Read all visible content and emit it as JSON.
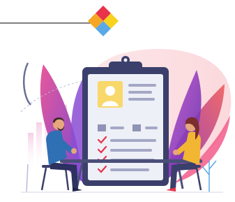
{
  "illustration": {
    "subject": "recruitment-interview",
    "colors": {
      "accent_red": "#e8334a",
      "accent_orange": "#f5a623",
      "accent_yellow": "#f8d21c",
      "accent_blue": "#5aa9e6",
      "clipboard_frame": "#3b3f6b",
      "paper": "#eef0f7",
      "check": "#e8334a",
      "leaf_purple": "#7b4bd1",
      "leaf_pink": "#e8579b",
      "man_shirt": "#2f6fb3",
      "woman_shirt": "#f2b632",
      "table": "#4a4f7a"
    }
  }
}
